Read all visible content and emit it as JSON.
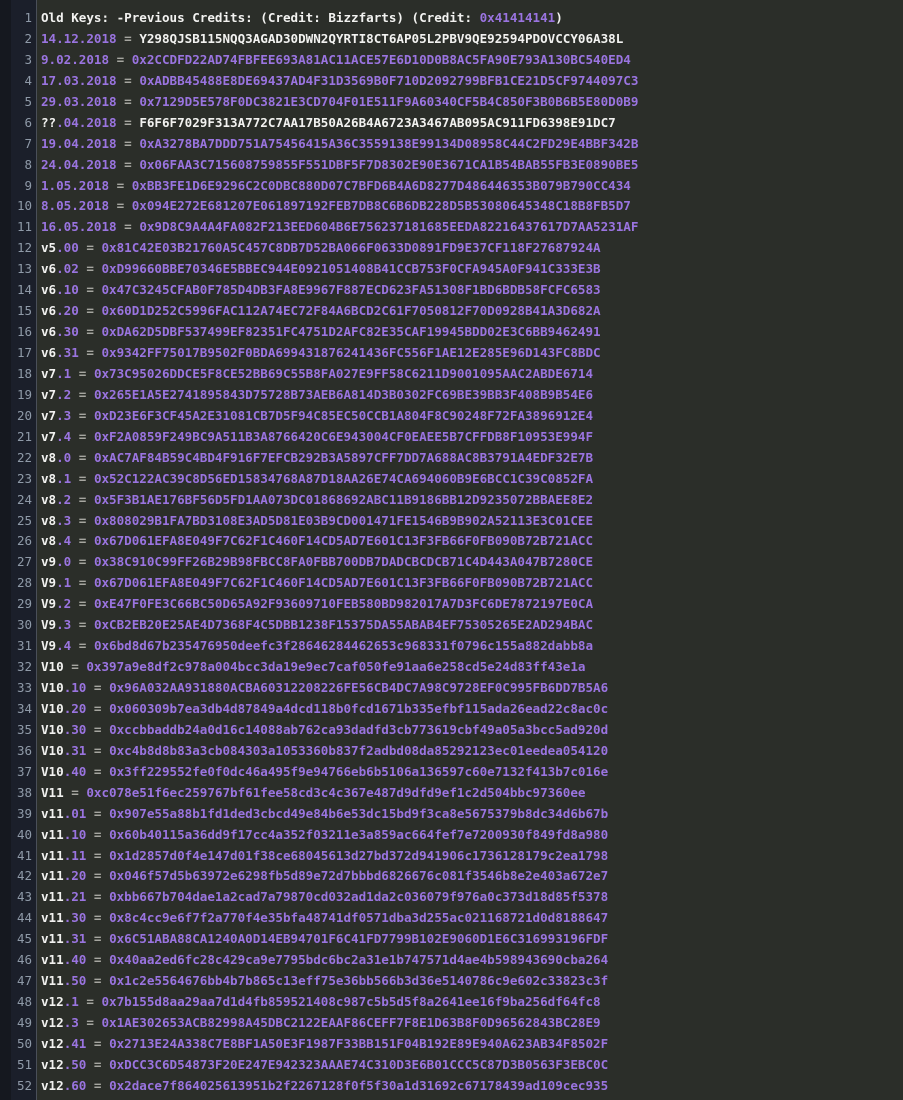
{
  "editor": {
    "kind": "code-text-viewer",
    "colors": {
      "background": "#2b2e29",
      "gutter_background": "#1b1f2a",
      "edge_strip": "#15181f",
      "gutter_divider": "#4a4f59",
      "line_number": "#8f9aa8",
      "plain_text": "#f2f2f0",
      "constant_purple": "#9a74e0",
      "operator_gray": "#a6a6a0"
    },
    "first_line_number": 1,
    "last_line_number": 52,
    "total_lines": 52
  },
  "lines": [
    {
      "n": 1,
      "tokens": [
        {
          "t": "Old Keys: -Previous Credits: (Credit: Bizzfarts) (Credit: ",
          "c": "plain"
        },
        {
          "t": "0x41414141",
          "c": "const"
        },
        {
          "t": ")",
          "c": "plain"
        }
      ]
    },
    {
      "n": 2,
      "tokens": [
        {
          "t": "14.12.2018",
          "c": "const"
        },
        {
          "t": " = ",
          "c": "op"
        },
        {
          "t": "Y298QJSB115NQQ3AGAD30DWN2QYRTI8CT6AP05L2PBV9QE92594PDOVCCY06A38L",
          "c": "plain"
        }
      ]
    },
    {
      "n": 3,
      "tokens": [
        {
          "t": "9.02.2018",
          "c": "const"
        },
        {
          "t": " = ",
          "c": "op"
        },
        {
          "t": "0x2CCDFD22AD74FBFEE693A81AC11ACE57E6D10D0B8AC5FA90E793A130BC540ED4",
          "c": "const"
        }
      ]
    },
    {
      "n": 4,
      "tokens": [
        {
          "t": "17.03.2018",
          "c": "const"
        },
        {
          "t": " = ",
          "c": "op"
        },
        {
          "t": "0xADBB45488E8DE69437AD4F31D3569B0F710D2092799BFB1CE21D5CF9744097C3",
          "c": "const"
        }
      ]
    },
    {
      "n": 5,
      "tokens": [
        {
          "t": "29.03.2018",
          "c": "const"
        },
        {
          "t": " = ",
          "c": "op"
        },
        {
          "t": "0x7129D5E578F0DC3821E3CD704F01E511F9A60340CF5B4C850F3B0B6B5E80D0B9",
          "c": "const"
        }
      ]
    },
    {
      "n": 6,
      "tokens": [
        {
          "t": "??",
          "c": "plain"
        },
        {
          "t": ".04.2018",
          "c": "const"
        },
        {
          "t": " = ",
          "c": "op"
        },
        {
          "t": "F6F6F7029F313A772C7AA17B50A26B4A6723A3467AB095AC911FD6398E91DC7",
          "c": "plain"
        }
      ]
    },
    {
      "n": 7,
      "tokens": [
        {
          "t": "19.04.2018",
          "c": "const"
        },
        {
          "t": " = ",
          "c": "op"
        },
        {
          "t": "0xA3278BA7DDD751A75456415A36C3559138E99134D08958C44C2FD29E4BBF342B",
          "c": "const"
        }
      ]
    },
    {
      "n": 8,
      "tokens": [
        {
          "t": "24.04.2018",
          "c": "const"
        },
        {
          "t": " = ",
          "c": "op"
        },
        {
          "t": "0x06FAA3C715608759855F551DBF5F7D8302E90E3671CA1B54BAB55FB3E0890BE5",
          "c": "const"
        }
      ]
    },
    {
      "n": 9,
      "tokens": [
        {
          "t": "1.05.2018",
          "c": "const"
        },
        {
          "t": " = ",
          "c": "op"
        },
        {
          "t": "0xBB3FE1D6E9296C2C0DBC880D07C7BFD6B4A6D8277D486446353B079B790CC434",
          "c": "const"
        }
      ]
    },
    {
      "n": 10,
      "tokens": [
        {
          "t": "8.05.2018",
          "c": "const"
        },
        {
          "t": " = ",
          "c": "op"
        },
        {
          "t": "0x094E272E681207E061897192FEB7DB8C6B6DB228D5B53080645348C18B8FB5D7",
          "c": "const"
        }
      ]
    },
    {
      "n": 11,
      "tokens": [
        {
          "t": "16.05.2018",
          "c": "const"
        },
        {
          "t": " = ",
          "c": "op"
        },
        {
          "t": "0x9D8C9A4A4FA082F213EED604B6E756237181685EEDA82216437617D7AA5231AF",
          "c": "const"
        }
      ]
    },
    {
      "n": 12,
      "tokens": [
        {
          "t": "v5",
          "c": "plain"
        },
        {
          "t": ".00",
          "c": "const"
        },
        {
          "t": " = ",
          "c": "op"
        },
        {
          "t": "0x81C42E03B21760A5C457C8DB7D52BA066F0633D0891FD9E37CF118F27687924A",
          "c": "const"
        }
      ]
    },
    {
      "n": 13,
      "tokens": [
        {
          "t": "v6",
          "c": "plain"
        },
        {
          "t": ".02",
          "c": "const"
        },
        {
          "t": " = ",
          "c": "op"
        },
        {
          "t": "0xD99660BBE70346E5BBEC944E0921051408B41CCB753F0CFA945A0F941C333E3B",
          "c": "const"
        }
      ]
    },
    {
      "n": 14,
      "tokens": [
        {
          "t": "v6",
          "c": "plain"
        },
        {
          "t": ".10",
          "c": "const"
        },
        {
          "t": " = ",
          "c": "op"
        },
        {
          "t": "0x47C3245CFAB0F785D4DB3FA8E9967F887ECD623FA51308F1BD6BDB58FCFC6583",
          "c": "const"
        }
      ]
    },
    {
      "n": 15,
      "tokens": [
        {
          "t": "v6",
          "c": "plain"
        },
        {
          "t": ".20",
          "c": "const"
        },
        {
          "t": " = ",
          "c": "op"
        },
        {
          "t": "0x60D1D252C5996FAC112A74EC72F84A6BCD2C61F7050812F70D0928B41A3D682A",
          "c": "const"
        }
      ]
    },
    {
      "n": 16,
      "tokens": [
        {
          "t": "v6",
          "c": "plain"
        },
        {
          "t": ".30",
          "c": "const"
        },
        {
          "t": " = ",
          "c": "op"
        },
        {
          "t": "0xDA62D5DBF537499EF82351FC4751D2AFC82E35CAF19945BDD02E3C6BB9462491",
          "c": "const"
        }
      ]
    },
    {
      "n": 17,
      "tokens": [
        {
          "t": "v6",
          "c": "plain"
        },
        {
          "t": ".31",
          "c": "const"
        },
        {
          "t": " = ",
          "c": "op"
        },
        {
          "t": "0x9342FF75017B9502F0BDA699431876241436FC556F1AE12E285E96D143FC8BDC",
          "c": "const"
        }
      ]
    },
    {
      "n": 18,
      "tokens": [
        {
          "t": "v7",
          "c": "plain"
        },
        {
          "t": ".1",
          "c": "const"
        },
        {
          "t": " = ",
          "c": "op"
        },
        {
          "t": "0x73C95026DDCE5F8CE52BB69C55B8FA027E9FF58C6211D9001095AAC2ABDE6714",
          "c": "const"
        }
      ]
    },
    {
      "n": 19,
      "tokens": [
        {
          "t": "v7",
          "c": "plain"
        },
        {
          "t": ".2",
          "c": "const"
        },
        {
          "t": " = ",
          "c": "op"
        },
        {
          "t": "0x265E1A5E2741895843D75728B73AEB6A814D3B0302FC69BE39BB3F408B9B54E6",
          "c": "const"
        }
      ]
    },
    {
      "n": 20,
      "tokens": [
        {
          "t": "v7",
          "c": "plain"
        },
        {
          "t": ".3",
          "c": "const"
        },
        {
          "t": " = ",
          "c": "op"
        },
        {
          "t": "0xD23E6F3CF45A2E31081CB7D5F94C85EC50CCB1A804F8C90248F72FA3896912E4",
          "c": "const"
        }
      ]
    },
    {
      "n": 21,
      "tokens": [
        {
          "t": "v7",
          "c": "plain"
        },
        {
          "t": ".4",
          "c": "const"
        },
        {
          "t": " = ",
          "c": "op"
        },
        {
          "t": "0xF2A0859F249BC9A511B3A8766420C6E943004CF0EAEE5B7CFFDB8F10953E994F",
          "c": "const"
        }
      ]
    },
    {
      "n": 22,
      "tokens": [
        {
          "t": "v8",
          "c": "plain"
        },
        {
          "t": ".0",
          "c": "const"
        },
        {
          "t": " = ",
          "c": "op"
        },
        {
          "t": "0xAC7AF84B59C4BD4F916F7EFCB292B3A5897CFF7DD7A688AC8B3791A4EDF32E7B",
          "c": "const"
        }
      ]
    },
    {
      "n": 23,
      "tokens": [
        {
          "t": "v8",
          "c": "plain"
        },
        {
          "t": ".1",
          "c": "const"
        },
        {
          "t": " = ",
          "c": "op"
        },
        {
          "t": "0x52C122AC39C8D56ED15834768A87D18AA26E74CA694060B9E6BCC1C39C0852FA",
          "c": "const"
        }
      ]
    },
    {
      "n": 24,
      "tokens": [
        {
          "t": "v8",
          "c": "plain"
        },
        {
          "t": ".2",
          "c": "const"
        },
        {
          "t": " = ",
          "c": "op"
        },
        {
          "t": "0x5F3B1AE176BF56D5FD1AA073DC01868692ABC11B9186BB12D9235072BBAEE8E2",
          "c": "const"
        }
      ]
    },
    {
      "n": 25,
      "tokens": [
        {
          "t": "v8",
          "c": "plain"
        },
        {
          "t": ".3",
          "c": "const"
        },
        {
          "t": " = ",
          "c": "op"
        },
        {
          "t": "0x808029B1FA7BD3108E3AD5D81E03B9CD001471FE1546B9B902A52113E3C01CEE",
          "c": "const"
        }
      ]
    },
    {
      "n": 26,
      "tokens": [
        {
          "t": "v8",
          "c": "plain"
        },
        {
          "t": ".4",
          "c": "const"
        },
        {
          "t": " = ",
          "c": "op"
        },
        {
          "t": "0x67D061EFA8E049F7C62F1C460F14CD5AD7E601C13F3FB66F0FB090B72B721ACC",
          "c": "const"
        }
      ]
    },
    {
      "n": 27,
      "tokens": [
        {
          "t": "v9",
          "c": "plain"
        },
        {
          "t": ".0",
          "c": "const"
        },
        {
          "t": " = ",
          "c": "op"
        },
        {
          "t": "0x38C910C99FF26B29B98FBCC8FA0FBB700DB7DADCBCDCB71C4D443A047B7280CE",
          "c": "const"
        }
      ]
    },
    {
      "n": 28,
      "tokens": [
        {
          "t": "V9",
          "c": "plain"
        },
        {
          "t": ".1",
          "c": "const"
        },
        {
          "t": " = ",
          "c": "op"
        },
        {
          "t": "0x67D061EFA8E049F7C62F1C460F14CD5AD7E601C13F3FB66F0FB090B72B721ACC",
          "c": "const"
        }
      ]
    },
    {
      "n": 29,
      "tokens": [
        {
          "t": "V9",
          "c": "plain"
        },
        {
          "t": ".2",
          "c": "const"
        },
        {
          "t": " = ",
          "c": "op"
        },
        {
          "t": "0xE47F0FE3C66BC50D65A92F93609710FEB580BD982017A7D3FC6DE7872197E0CA",
          "c": "const"
        }
      ]
    },
    {
      "n": 30,
      "tokens": [
        {
          "t": "V9",
          "c": "plain"
        },
        {
          "t": ".3",
          "c": "const"
        },
        {
          "t": " = ",
          "c": "op"
        },
        {
          "t": "0xCB2EB20E25AE4D7368F4C5DBB1238F15375DA55ABAB4EF75305265E2AD294BAC",
          "c": "const"
        }
      ]
    },
    {
      "n": 31,
      "tokens": [
        {
          "t": "V9",
          "c": "plain"
        },
        {
          "t": ".4",
          "c": "const"
        },
        {
          "t": " = ",
          "c": "op"
        },
        {
          "t": "0x6bd8d67b235476950deefc3f28646284462653c968331f0796c155a882dabb8a",
          "c": "const"
        }
      ]
    },
    {
      "n": 32,
      "tokens": [
        {
          "t": "V10",
          "c": "plain"
        },
        {
          "t": " = ",
          "c": "op"
        },
        {
          "t": "0x397a9e8df2c978a004bcc3da19e9ec7caf050fe91aa6e258cd5e24d83ff43e1a",
          "c": "const"
        }
      ]
    },
    {
      "n": 33,
      "tokens": [
        {
          "t": "V10",
          "c": "plain"
        },
        {
          "t": ".10",
          "c": "const"
        },
        {
          "t": " = ",
          "c": "op"
        },
        {
          "t": "0x96A032AA931880ACBA60312208226FE56CB4DC7A98C9728EF0C995FB6DD7B5A6",
          "c": "const"
        }
      ]
    },
    {
      "n": 34,
      "tokens": [
        {
          "t": "V10",
          "c": "plain"
        },
        {
          "t": ".20",
          "c": "const"
        },
        {
          "t": " = ",
          "c": "op"
        },
        {
          "t": "0x060309b7ea3db4d87849a4dcd118b0fcd1671b335efbf115ada26ead22c8ac0c",
          "c": "const"
        }
      ]
    },
    {
      "n": 35,
      "tokens": [
        {
          "t": "V10",
          "c": "plain"
        },
        {
          "t": ".30",
          "c": "const"
        },
        {
          "t": " = ",
          "c": "op"
        },
        {
          "t": "0xccbbaddb24a0d16c14088ab762ca93dadfd3cb773619cbf49a05a3bcc5ad920d",
          "c": "const"
        }
      ]
    },
    {
      "n": 36,
      "tokens": [
        {
          "t": "V10",
          "c": "plain"
        },
        {
          "t": ".31",
          "c": "const"
        },
        {
          "t": " = ",
          "c": "op"
        },
        {
          "t": "0xc4b8d8b83a3cb084303a1053360b837f2adbd08da85292123ec01eedea054120",
          "c": "const"
        }
      ]
    },
    {
      "n": 37,
      "tokens": [
        {
          "t": "V10",
          "c": "plain"
        },
        {
          "t": ".40",
          "c": "const"
        },
        {
          "t": " = ",
          "c": "op"
        },
        {
          "t": "0x3ff229552fe0f0dc46a495f9e94766eb6b5106a136597c60e7132f413b7c016e",
          "c": "const"
        }
      ]
    },
    {
      "n": 38,
      "tokens": [
        {
          "t": "V11",
          "c": "plain"
        },
        {
          "t": " = ",
          "c": "op"
        },
        {
          "t": "0xc078e51f6ec259767bf61fee58cd3c4c367e487d9dfd9ef1c2d504bbc97360ee",
          "c": "const"
        }
      ]
    },
    {
      "n": 39,
      "tokens": [
        {
          "t": "v11",
          "c": "plain"
        },
        {
          "t": ".01",
          "c": "const"
        },
        {
          "t": " = ",
          "c": "op"
        },
        {
          "t": "0x907e55a88b1fd1ded3cbcd49e84b6e53dc15bd9f3ca8e5675379b8dc34d6b67b",
          "c": "const"
        }
      ]
    },
    {
      "n": 40,
      "tokens": [
        {
          "t": "v11",
          "c": "plain"
        },
        {
          "t": ".10",
          "c": "const"
        },
        {
          "t": " = ",
          "c": "op"
        },
        {
          "t": "0x60b40115a36dd9f17cc4a352f03211e3a859ac664fef7e7200930f849fd8a980",
          "c": "const"
        }
      ]
    },
    {
      "n": 41,
      "tokens": [
        {
          "t": "v11",
          "c": "plain"
        },
        {
          "t": ".11",
          "c": "const"
        },
        {
          "t": " = ",
          "c": "op"
        },
        {
          "t": "0x1d2857d0f4e147d01f38ce68045613d27bd372d941906c1736128179c2ea1798",
          "c": "const"
        }
      ]
    },
    {
      "n": 42,
      "tokens": [
        {
          "t": "v11",
          "c": "plain"
        },
        {
          "t": ".20",
          "c": "const"
        },
        {
          "t": " = ",
          "c": "op"
        },
        {
          "t": "0x046f57d5b63972e6298fb5d89e72d7bbbd6826676c081f3546b8e2e403a672e7",
          "c": "const"
        }
      ]
    },
    {
      "n": 43,
      "tokens": [
        {
          "t": "v11",
          "c": "plain"
        },
        {
          "t": ".21",
          "c": "const"
        },
        {
          "t": " = ",
          "c": "op"
        },
        {
          "t": "0xbb667b704dae1a2cad7a79870cd032ad1da2c036079f976a0c373d18d85f5378",
          "c": "const"
        }
      ]
    },
    {
      "n": 44,
      "tokens": [
        {
          "t": "v11",
          "c": "plain"
        },
        {
          "t": ".30",
          "c": "const"
        },
        {
          "t": " = ",
          "c": "op"
        },
        {
          "t": "0x8c4cc9e6f7f2a770f4e35bfa48741df0571dba3d255ac021168721d0d8188647",
          "c": "const"
        }
      ]
    },
    {
      "n": 45,
      "tokens": [
        {
          "t": "v11",
          "c": "plain"
        },
        {
          "t": ".31",
          "c": "const"
        },
        {
          "t": " = ",
          "c": "op"
        },
        {
          "t": "0x6C51ABA88CA1240A0D14EB94701F6C41FD7799B102E9060D1E6C316993196FDF",
          "c": "const"
        }
      ]
    },
    {
      "n": 46,
      "tokens": [
        {
          "t": "v11",
          "c": "plain"
        },
        {
          "t": ".40",
          "c": "const"
        },
        {
          "t": " = ",
          "c": "op"
        },
        {
          "t": "0x40aa2ed6fc28c429ca9e7795bdc6bc2a31e1b747571d4ae4b598943690cba264",
          "c": "const"
        }
      ]
    },
    {
      "n": 47,
      "tokens": [
        {
          "t": "V11",
          "c": "plain"
        },
        {
          "t": ".50",
          "c": "const"
        },
        {
          "t": " = ",
          "c": "op"
        },
        {
          "t": "0x1c2e5564676bb4b7b865c13eff75e36bb566b3d36e5140786c9e602c33823c3f",
          "c": "const"
        }
      ]
    },
    {
      "n": 48,
      "tokens": [
        {
          "t": "v12",
          "c": "plain"
        },
        {
          "t": ".1",
          "c": "const"
        },
        {
          "t": " = ",
          "c": "op"
        },
        {
          "t": "0x7b155d8aa29aa7d1d4fb859521408c987c5b5d5f8a2641ee16f9ba256df64fc8",
          "c": "const"
        }
      ]
    },
    {
      "n": 49,
      "tokens": [
        {
          "t": "v12",
          "c": "plain"
        },
        {
          "t": ".3",
          "c": "const"
        },
        {
          "t": " = ",
          "c": "op"
        },
        {
          "t": "0x1AE302653ACB82998A45DBC2122EAAF86CEFF7F8E1D63B8F0D96562843BC28E9",
          "c": "const"
        }
      ]
    },
    {
      "n": 50,
      "tokens": [
        {
          "t": "v12",
          "c": "plain"
        },
        {
          "t": ".41",
          "c": "const"
        },
        {
          "t": " = ",
          "c": "op"
        },
        {
          "t": "0x2713E24A338C7E8BF1A50E3F1987F33BB151F04B192E89E940A623AB34F8502F",
          "c": "const"
        }
      ]
    },
    {
      "n": 51,
      "tokens": [
        {
          "t": "v12",
          "c": "plain"
        },
        {
          "t": ".50",
          "c": "const"
        },
        {
          "t": " = ",
          "c": "op"
        },
        {
          "t": "0xDCC3C6D54873F20E247E942323AAAE74C310D3E6B01CCC5C87D3B0563F3EBC0C",
          "c": "const"
        }
      ]
    },
    {
      "n": 52,
      "tokens": [
        {
          "t": "v12",
          "c": "plain"
        },
        {
          "t": ".60",
          "c": "const"
        },
        {
          "t": " = ",
          "c": "op"
        },
        {
          "t": "0x2dace7f864025613951b2f2267128f0f5f30a1d31692c67178439ad109cec935",
          "c": "const"
        }
      ]
    }
  ]
}
